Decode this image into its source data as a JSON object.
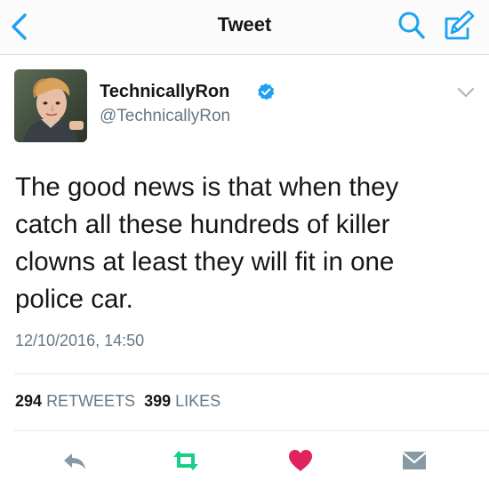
{
  "header": {
    "title": "Tweet",
    "back_icon": "chevron-left-icon",
    "search_icon": "search-icon",
    "compose_icon": "compose-icon"
  },
  "tweet": {
    "author": {
      "display_name": "TechnicallyRon",
      "handle": "@TechnicallyRon",
      "verified": true
    },
    "text": "The good news is that when they\ncatch all these hundreds of killer\nclowns at least they will fit in one\npolice car.",
    "timestamp": "12/10/2016, 14:50",
    "stats": {
      "retweets_count": "294",
      "retweets_label": "RETWEETS",
      "likes_count": "399",
      "likes_label": "LIKES"
    }
  },
  "actions": [
    {
      "icon": "reply-icon"
    },
    {
      "icon": "retweet-icon"
    },
    {
      "icon": "like-heart-icon"
    },
    {
      "icon": "direct-message-icon"
    }
  ],
  "colors": {
    "accent": "#1da1f2",
    "retweet": "#19cf86",
    "like": "#e0245e",
    "secondary_text": "#657786",
    "icon_gray": "#8899a6"
  }
}
